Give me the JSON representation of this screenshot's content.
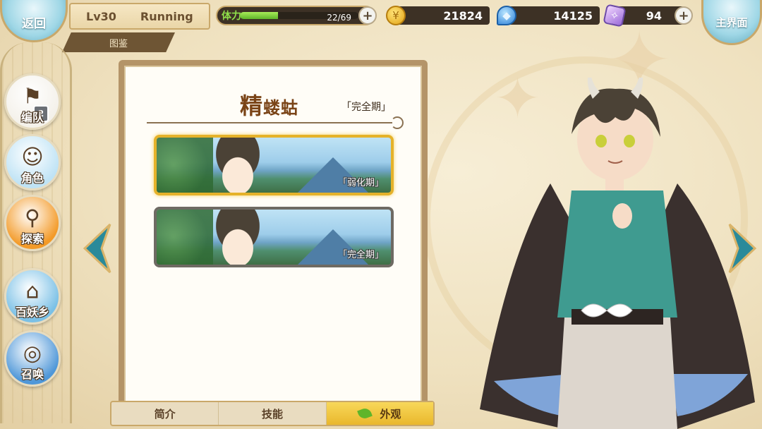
{
  "top_bar": {
    "back_label": "返回",
    "home_label": "主界面",
    "level": "Lv30",
    "player_name": "Running",
    "section_tab": "图鉴",
    "stamina_label": "体力",
    "stamina_text": "22/69",
    "stamina_fraction": 0.319,
    "coins": "21824",
    "soul": "14125",
    "crystals": "94"
  },
  "left_nav": {
    "items": [
      {
        "label": "编队",
        "icon": "team-icon",
        "badge": "2",
        "color": "#f4f1ea"
      },
      {
        "label": "角色",
        "icon": "character-icon",
        "color": "#bfe3f5"
      },
      {
        "label": "探索",
        "icon": "explore-icon",
        "color": "#f39a28"
      },
      {
        "label": "百妖乡",
        "icon": "village-icon",
        "color": "#7ac0e6"
      },
      {
        "label": "召唤",
        "icon": "summon-icon",
        "color": "#4f97d8"
      }
    ]
  },
  "panel": {
    "char_name_big": "精",
    "char_name_rest": "蝼蛄",
    "stage_tag": "「完全期」",
    "forms": [
      {
        "label": "「弱化期」",
        "selected": true
      },
      {
        "label": "「完全期」",
        "selected": false
      }
    ]
  },
  "tabs": {
    "intro": "简介",
    "skills": "技能",
    "appearance": "外观"
  },
  "colors": {
    "accent_gold": "#e9b72c",
    "frame_brown": "#b49468",
    "arrow_teal": "#2a8a9a"
  }
}
